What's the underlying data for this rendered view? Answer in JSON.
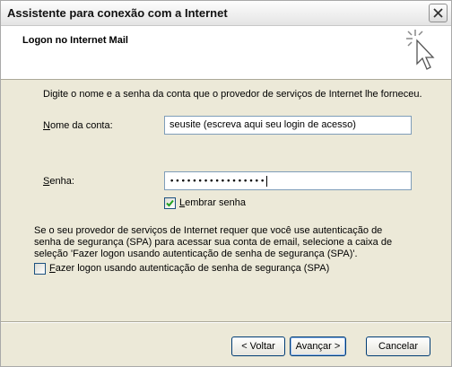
{
  "window": {
    "title": "Assistente para conexão com a Internet",
    "header_title": "Logon no Internet Mail"
  },
  "form": {
    "intro": "Digite o nome e a senha da conta que o provedor de serviços de Internet lhe forneceu.",
    "account_label": "Nome da conta:",
    "account_value": "seusite  (escreva aqui seu login de acesso)",
    "password_label": "Senha:",
    "password_mask": "•••••••••••••••••",
    "remember_label": "Lembrar senha",
    "remember_checked": true,
    "spa_text": "Se o seu provedor de serviços de Internet requer que você use autenticação de senha de segurança (SPA) para acessar sua conta de email, selecione a caixa de seleção 'Fazer logon usando autenticação de senha de segurança (SPA)'.",
    "spa_label": "Fazer logon usando autenticação de senha de segurança (SPA)",
    "spa_checked": false
  },
  "buttons": {
    "back": "< Voltar",
    "next": "Avançar >",
    "cancel": "Cancelar"
  },
  "icons": {
    "close": "close-icon",
    "wizard": "cursor-sparkle-icon",
    "check": "checkmark-icon"
  },
  "colors": {
    "dialog_bg": "#ece9d8",
    "checkmark": "#21a121",
    "input_border": "#7f9db9"
  }
}
